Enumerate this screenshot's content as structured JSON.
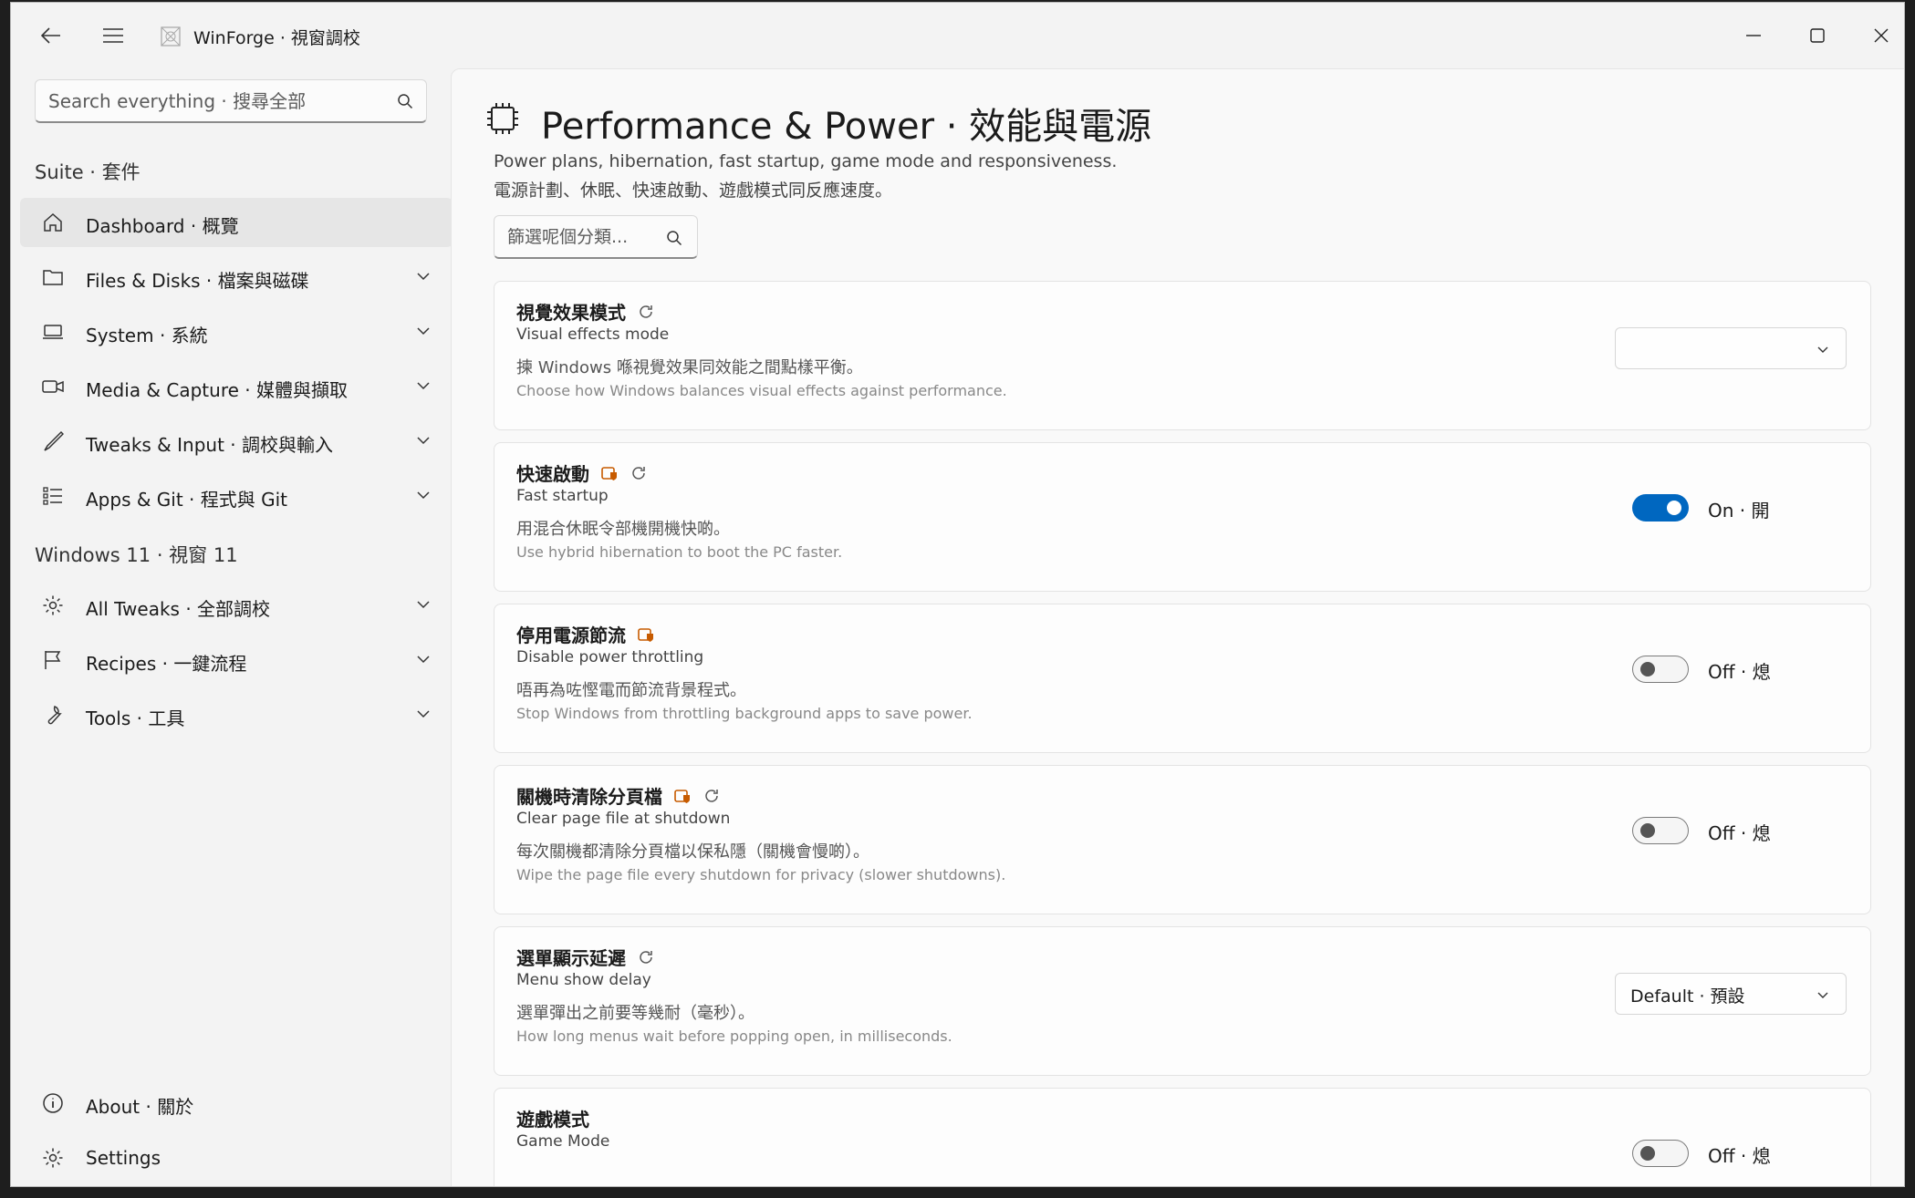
{
  "window": {
    "title": "WinForge · 視窗調校"
  },
  "sidebar": {
    "search_placeholder": "Search everything · 搜尋全部",
    "section_suite": "Suite · 套件",
    "section_windows": "Windows 11 · 視窗 11",
    "items": [
      {
        "label": "Dashboard · 概覽",
        "icon": "home-icon",
        "active": true
      },
      {
        "label": "Files & Disks · 檔案與磁碟",
        "icon": "folder-icon"
      },
      {
        "label": "System · 系統",
        "icon": "laptop-icon"
      },
      {
        "label": "Media & Capture · 媒體與擷取",
        "icon": "video-camera-icon"
      },
      {
        "label": "Tweaks & Input · 調校與輸入",
        "icon": "brush-icon"
      },
      {
        "label": "Apps & Git · 程式與 Git",
        "icon": "list-icon"
      },
      {
        "label": "All Tweaks · 全部調校",
        "icon": "gear-icon"
      },
      {
        "label": "Recipes · 一鍵流程",
        "icon": "flag-icon"
      },
      {
        "label": "Tools · 工具",
        "icon": "wrench-icon"
      }
    ],
    "footer": [
      {
        "label": "About · 關於",
        "icon": "info-icon"
      },
      {
        "label": "Settings",
        "icon": "gear-icon"
      }
    ]
  },
  "page": {
    "icon": "chip-icon",
    "title": "Performance & Power · 效能與電源",
    "subtitle_en": "Power plans, hibernation, fast startup, game mode and responsiveness.",
    "subtitle_zh": "電源計劃、休眠、快速啟動、遊戲模式同反應速度。",
    "filter_placeholder": "篩選呢個分類..."
  },
  "settings": [
    {
      "title_zh": "視覺效果模式",
      "title_en": "Visual effects mode",
      "desc_zh": "揀 Windows 喺視覺效果同效能之間點樣平衡。",
      "desc_en": "Choose how Windows balances visual effects against performance.",
      "control": "select",
      "value": "",
      "admin": false,
      "restart": true
    },
    {
      "title_zh": "快速啟動",
      "title_en": "Fast startup",
      "desc_zh": "用混合休眠令部機開機快啲。",
      "desc_en": "Use hybrid hibernation to boot the PC faster.",
      "control": "toggle",
      "on": true,
      "value": "On · 開",
      "admin": true,
      "restart": true
    },
    {
      "title_zh": "停用電源節流",
      "title_en": "Disable power throttling",
      "desc_zh": "唔再為咗慳電而節流背景程式。",
      "desc_en": "Stop Windows from throttling background apps to save power.",
      "control": "toggle",
      "on": false,
      "value": "Off · 熄",
      "admin": true,
      "restart": false
    },
    {
      "title_zh": "關機時清除分頁檔",
      "title_en": "Clear page file at shutdown",
      "desc_zh": "每次關機都清除分頁檔以保私隱（關機會慢啲）。",
      "desc_en": "Wipe the page file every shutdown for privacy (slower shutdowns).",
      "control": "toggle",
      "on": false,
      "value": "Off · 熄",
      "admin": true,
      "restart": true
    },
    {
      "title_zh": "選單顯示延遲",
      "title_en": "Menu show delay",
      "desc_zh": "選單彈出之前要等幾耐（毫秒）。",
      "desc_en": "How long menus wait before popping open, in milliseconds.",
      "control": "select",
      "value": "Default · 預設",
      "admin": false,
      "restart": true
    },
    {
      "title_zh": "遊戲模式",
      "title_en": "Game Mode",
      "desc_zh": "",
      "desc_en": "",
      "control": "toggle",
      "on": false,
      "value": "Off · 熄",
      "admin": false,
      "restart": false
    }
  ],
  "colors": {
    "accent": "#0067c0",
    "admin_badge": "#c75b00"
  }
}
